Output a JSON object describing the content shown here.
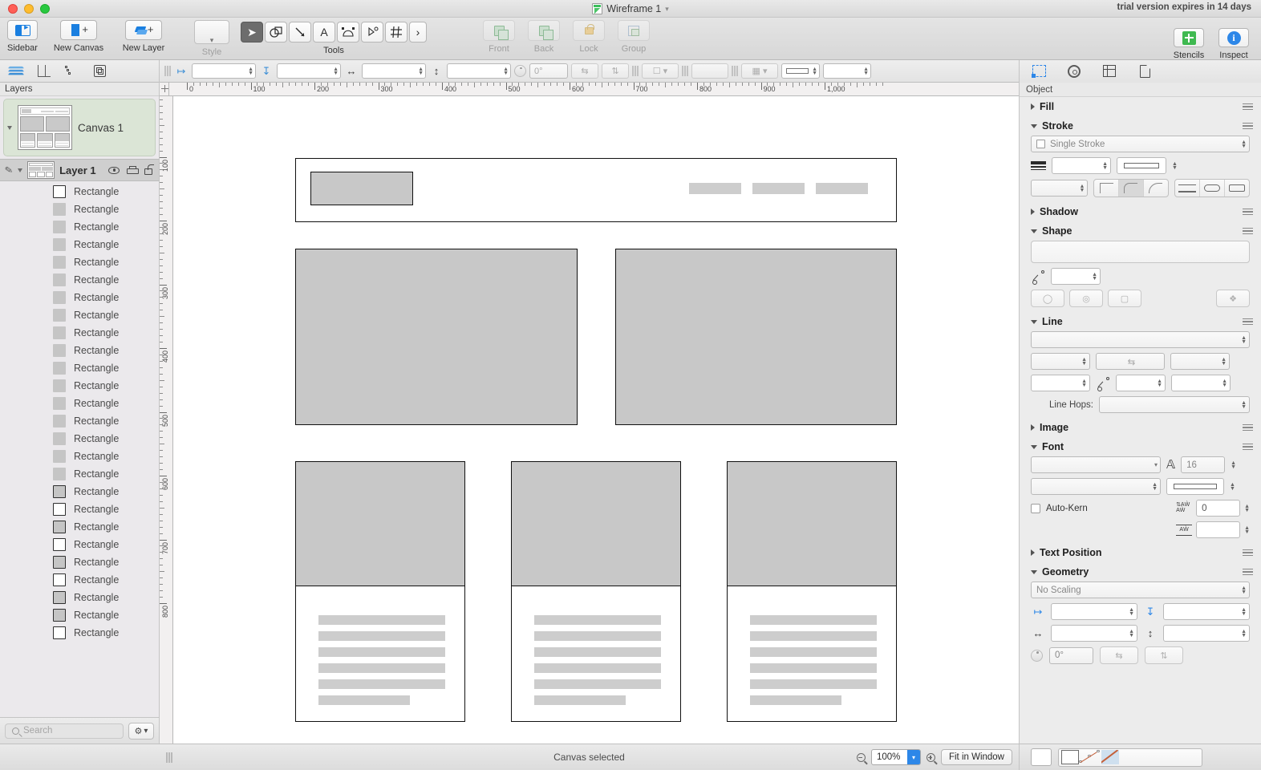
{
  "window": {
    "title": "Wireframe 1",
    "trial_notice": "trial version expires in 14 days"
  },
  "toolbar": {
    "items": [
      {
        "label": "Sidebar",
        "icon": "sidebar-icon"
      },
      {
        "label": "New Canvas",
        "icon": "new-canvas-icon"
      },
      {
        "label": "New Layer",
        "icon": "new-layer-icon"
      }
    ],
    "style_label": "Style",
    "tools_label": "Tools",
    "tools": [
      {
        "name": "selection-tool",
        "glyph": "➤",
        "active": true
      },
      {
        "name": "shape-tool",
        "glyph": "◯",
        "active": false
      },
      {
        "name": "line-tool",
        "glyph": "↘",
        "active": false
      },
      {
        "name": "text-tool",
        "glyph": "A",
        "active": false
      },
      {
        "name": "bezier-tool",
        "glyph": "⌢",
        "active": false
      },
      {
        "name": "point-editor-tool",
        "glyph": "⬡",
        "active": false
      },
      {
        "name": "grid-tool",
        "glyph": "#",
        "active": false
      },
      {
        "name": "more-tools",
        "glyph": "›",
        "active": false
      }
    ],
    "arrange": [
      {
        "label": "Front",
        "icon": "bring-front-icon"
      },
      {
        "label": "Back",
        "icon": "send-back-icon"
      },
      {
        "label": "Lock",
        "icon": "lock-icon"
      },
      {
        "label": "Group",
        "icon": "group-icon"
      }
    ],
    "right": [
      {
        "label": "Stencils",
        "icon": "stencils-icon"
      },
      {
        "label": "Inspect",
        "icon": "inspect-info-icon"
      }
    ]
  },
  "subbar": {
    "rotation_value": "0°"
  },
  "sidebar": {
    "header": "Layers",
    "canvas": {
      "name": "Canvas 1"
    },
    "layer": {
      "name": "Layer 1"
    },
    "shapes": [
      {
        "name": "Rectangle",
        "swatch": "outline-white"
      },
      {
        "name": "Rectangle",
        "swatch": "plain-gray"
      },
      {
        "name": "Rectangle",
        "swatch": "plain-gray"
      },
      {
        "name": "Rectangle",
        "swatch": "plain-gray"
      },
      {
        "name": "Rectangle",
        "swatch": "plain-gray"
      },
      {
        "name": "Rectangle",
        "swatch": "plain-gray"
      },
      {
        "name": "Rectangle",
        "swatch": "plain-gray"
      },
      {
        "name": "Rectangle",
        "swatch": "plain-gray"
      },
      {
        "name": "Rectangle",
        "swatch": "plain-gray"
      },
      {
        "name": "Rectangle",
        "swatch": "plain-gray"
      },
      {
        "name": "Rectangle",
        "swatch": "plain-gray"
      },
      {
        "name": "Rectangle",
        "swatch": "plain-gray"
      },
      {
        "name": "Rectangle",
        "swatch": "plain-gray"
      },
      {
        "name": "Rectangle",
        "swatch": "plain-gray"
      },
      {
        "name": "Rectangle",
        "swatch": "plain-gray"
      },
      {
        "name": "Rectangle",
        "swatch": "plain-gray"
      },
      {
        "name": "Rectangle",
        "swatch": "plain-gray"
      },
      {
        "name": "Rectangle",
        "swatch": "outline-gray"
      },
      {
        "name": "Rectangle",
        "swatch": "outline-white"
      },
      {
        "name": "Rectangle",
        "swatch": "outline-gray"
      },
      {
        "name": "Rectangle",
        "swatch": "outline-white"
      },
      {
        "name": "Rectangle",
        "swatch": "outline-gray"
      },
      {
        "name": "Rectangle",
        "swatch": "outline-white"
      },
      {
        "name": "Rectangle",
        "swatch": "outline-gray"
      },
      {
        "name": "Rectangle",
        "swatch": "outline-gray"
      },
      {
        "name": "Rectangle",
        "swatch": "outline-white"
      }
    ],
    "search_placeholder": "Search"
  },
  "rulers": {
    "horizontal_labels": [
      "0",
      "100",
      "200",
      "300",
      "400",
      "500",
      "600",
      "700",
      "800",
      "900",
      "1,000"
    ],
    "vertical_labels": [
      "100",
      "200",
      "300",
      "400",
      "500",
      "600",
      "700",
      "800"
    ]
  },
  "inspector": {
    "title": "Object",
    "sections": {
      "fill": {
        "label": "Fill",
        "expanded": false
      },
      "stroke": {
        "label": "Stroke",
        "expanded": true,
        "type_value": "Single Stroke"
      },
      "shadow": {
        "label": "Shadow",
        "expanded": false
      },
      "shape": {
        "label": "Shape",
        "expanded": true
      },
      "line": {
        "label": "Line",
        "expanded": true,
        "hops_label": "Line Hops:"
      },
      "image": {
        "label": "Image",
        "expanded": false
      },
      "font": {
        "label": "Font",
        "expanded": true,
        "size_value": "16",
        "autokern_label": "Auto-Kern",
        "kern_value": "0"
      },
      "text_position": {
        "label": "Text Position",
        "expanded": false
      },
      "geometry": {
        "label": "Geometry",
        "expanded": true,
        "scaling_value": "No Scaling",
        "rotation_value": "0°"
      }
    }
  },
  "statusbar": {
    "status_text": "Canvas selected",
    "zoom_value": "100%",
    "fit_label": "Fit in Window"
  },
  "canvas_content": {
    "header": {
      "logo": "logo-placeholder",
      "nav_items": 3
    },
    "hero_blocks": 2,
    "cards": [
      {
        "text_lines": 6
      },
      {
        "text_lines": 6
      },
      {
        "text_lines": 6
      }
    ]
  }
}
